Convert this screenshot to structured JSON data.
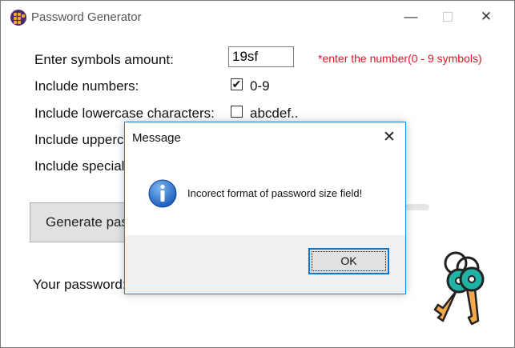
{
  "window": {
    "title": "Password Generator",
    "minimize_glyph": "—",
    "close_glyph": "✕"
  },
  "form": {
    "symbols_label": "Enter symbols amount:",
    "symbols_value": "19sf",
    "symbols_warning": "*enter the number(0 - 9 symbols)",
    "numbers_label": "Include numbers:",
    "numbers_checked": true,
    "numbers_hint": "0-9",
    "lowercase_label": "Include lowercase characters:",
    "lowercase_checked": false,
    "lowercase_hint": "abcdef..",
    "uppercase_label": "Include upperc",
    "special_label": "Include special",
    "generate_label": "Generate pas",
    "password_label": "Your password:",
    "password_value": ""
  },
  "dialog": {
    "title": "Message",
    "close_glyph": "✕",
    "message": "Incorect format of password size field!",
    "ok_label": "OK",
    "icon": "info-icon"
  },
  "colors": {
    "warning": "#e81123",
    "dialog_border": "#1883d7",
    "ok_focus": "#0078d7",
    "key_teal": "#1fb3a5",
    "key_orange": "#f5a94a"
  }
}
